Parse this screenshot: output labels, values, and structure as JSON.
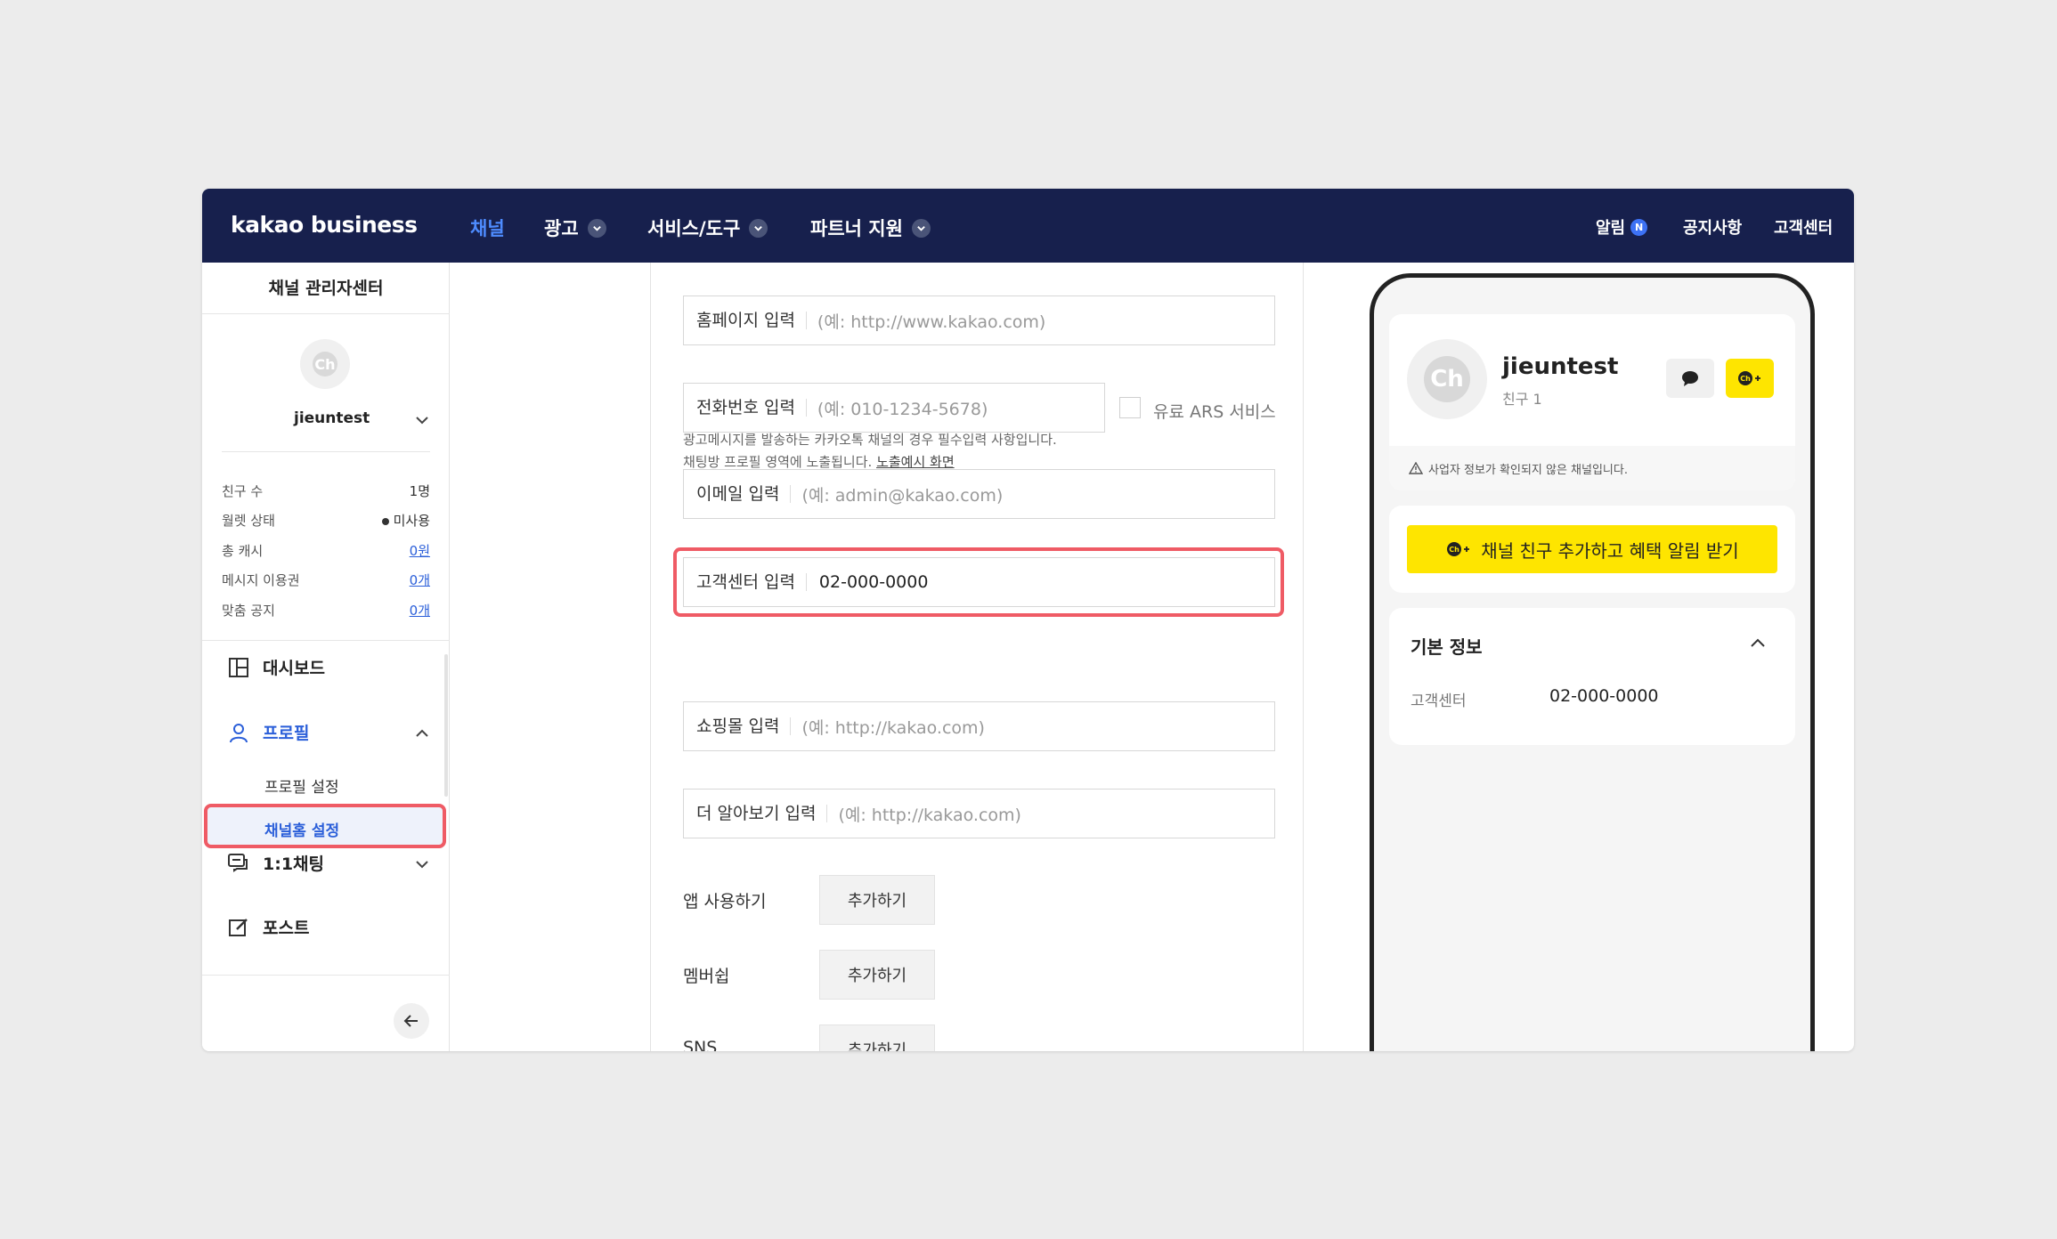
{
  "nav": {
    "logo": "kakao business",
    "items": [
      "채널",
      "광고",
      "서비스/도구",
      "파트너 지원"
    ],
    "right": {
      "alerts": "알림",
      "alerts_badge": "N",
      "notices": "공지사항",
      "support": "고객센터"
    }
  },
  "sidebar": {
    "title": "채널 관리자센터",
    "avatar_text": "Ch",
    "channel_name": "jieuntest",
    "stats": [
      {
        "label": "친구 수",
        "value": "1명"
      },
      {
        "label": "월렛 상태",
        "value": "미사용"
      },
      {
        "label": "총 캐시",
        "value": "0원"
      },
      {
        "label": "메시지 이용권",
        "value": "0개"
      },
      {
        "label": "맞춤 공지",
        "value": "0개"
      }
    ],
    "menu": {
      "dashboard": "대시보드",
      "profile": "프로필",
      "profile_settings": "프로필 설정",
      "channel_home_settings": "채널홈 설정",
      "chat": "1:1채팅",
      "post": "포스트"
    }
  },
  "form": {
    "homepage": {
      "label": "홈페이지 입력",
      "placeholder": "(예: http://www.kakao.com)"
    },
    "phone": {
      "label": "전화번호 입력",
      "placeholder": "(예: 010-1234-5678)"
    },
    "ars": "유료 ARS 서비스",
    "email": {
      "label": "이메일 입력",
      "placeholder": "(예: admin@kakao.com)"
    },
    "support": {
      "label": "고객센터 입력",
      "value": "02-000-0000"
    },
    "helper_line1": "광고메시지를 발송하는 카카오톡 채널의 경우 필수입력 사항입니다.",
    "helper_line2": "채팅방 프로필 영역에 노출됩니다.",
    "helper_link": "노출예시 화면",
    "shop": {
      "label": "쇼핑몰 입력",
      "placeholder": "(예: http://kakao.com)"
    },
    "more": {
      "label": "더 알아보기 입력",
      "placeholder": "(예: http://kakao.com)"
    },
    "app": {
      "label": "앱 사용하기",
      "button": "추가하기"
    },
    "membership": {
      "label": "멤버쉽",
      "button": "추가하기"
    },
    "sns": {
      "label": "SNS",
      "button": "추가하기"
    }
  },
  "preview": {
    "avatar_text": "Ch",
    "name": "jieuntest",
    "friends": "친구 1",
    "warning": "사업자 정보가 확인되지 않은 채널입니다.",
    "add_friend": "채널 친구 추가하고 혜택 알림 받기",
    "info_title": "기본 정보",
    "info_key": "고객센터",
    "info_value": "02-000-0000"
  },
  "colors": {
    "nav_bg": "#17204d",
    "accent": "#2b5fd9",
    "highlight": "#ef5b65",
    "kakao_yellow": "#fee500"
  }
}
